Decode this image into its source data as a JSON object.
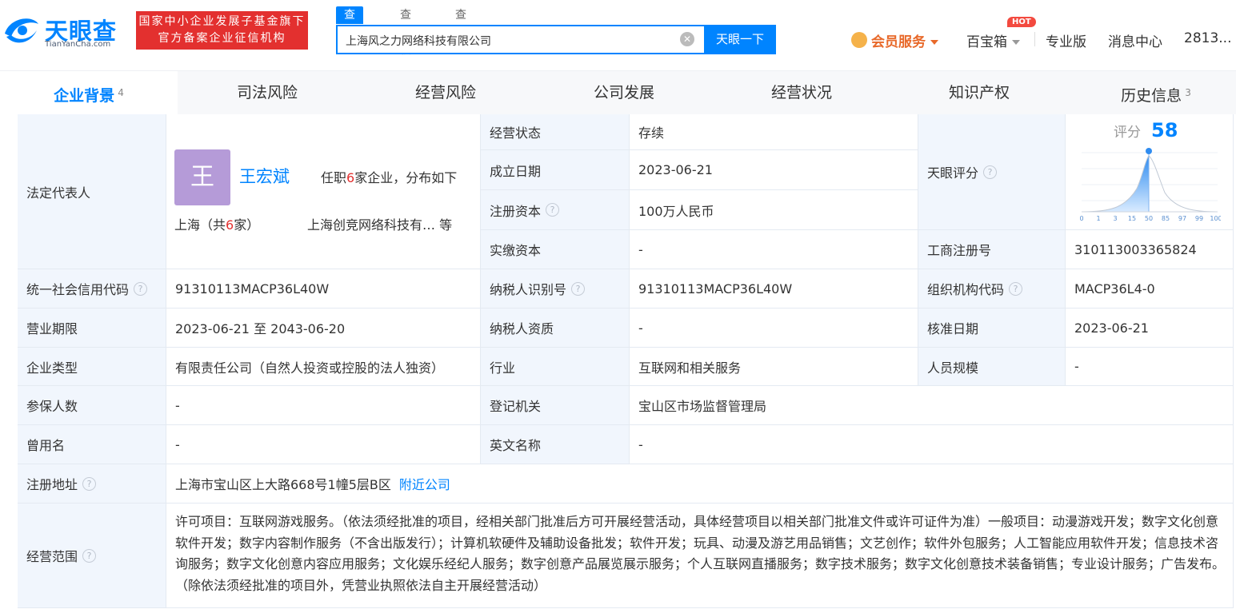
{
  "header": {
    "logo_text": "天眼查",
    "logo_sub": "TianYanCha.com",
    "gov_badge_line1": "国家中小企业发展子基金旗下",
    "gov_badge_line2": "官方备案企业征信机构",
    "search_tabs": [
      "查公司",
      "查老板",
      "查关系"
    ],
    "search_value": "上海风之力网络科技有限公司",
    "search_button": "天眼一下",
    "vip_label": "会员服务",
    "treasure_label": "百宝箱",
    "hot_badge": "HOT",
    "pro_label": "专业版",
    "message_label": "消息中心",
    "user_label": "2813..."
  },
  "tabs": [
    {
      "label": "企业背景",
      "count": "4"
    },
    {
      "label": "司法风险",
      "count": ""
    },
    {
      "label": "经营风险",
      "count": ""
    },
    {
      "label": "公司发展",
      "count": ""
    },
    {
      "label": "经营状况",
      "count": ""
    },
    {
      "label": "知识产权",
      "count": ""
    },
    {
      "label": "历史信息",
      "count": "3"
    }
  ],
  "info": {
    "legal_rep_label": "法定代表人",
    "avatar_char": "王",
    "legal_rep_name": "王宏斌",
    "rep_count_prefix": "任职",
    "rep_count_num": "6",
    "rep_count_suffix": "家企业，分布如下",
    "rep_loc_prefix": "上海（共",
    "rep_loc_num": "6",
    "rep_loc_suffix": "家）",
    "rep_company": "上海创竞网络科技有…  等",
    "status_label": "经营状态",
    "status_value": "存续",
    "found_label": "成立日期",
    "found_value": "2023-06-21",
    "capital_label": "注册资本",
    "capital_value": "100万人民币",
    "paid_label": "实缴资本",
    "paid_value": "-",
    "score_cell_label": "天眼评分",
    "score_label": "评分",
    "score_value": "58",
    "score_axis": [
      "0",
      "1",
      "3",
      "15",
      "50",
      "85",
      "97",
      "99",
      "100"
    ],
    "reg_no_label": "工商注册号",
    "reg_no_value": "310113003365824",
    "credit_label": "统一社会信用代码",
    "credit_value": "91310113MACP36L40W",
    "taxid_label": "纳税人识别号",
    "taxid_value": "91310113MACP36L40W",
    "org_label": "组织机构代码",
    "org_value": "MACP36L4-0",
    "term_label": "营业期限",
    "term_value": "2023-06-21 至 2043-06-20",
    "tax_qual_label": "纳税人资质",
    "tax_qual_value": "-",
    "approve_label": "核准日期",
    "approve_value": "2023-06-21",
    "type_label": "企业类型",
    "type_value": "有限责任公司（自然人投资或控股的法人独资）",
    "industry_label": "行业",
    "industry_value": "互联网和相关服务",
    "staff_label": "人员规模",
    "staff_value": "-",
    "insured_label": "参保人数",
    "insured_value": "-",
    "authority_label": "登记机关",
    "authority_value": "宝山区市场监督管理局",
    "former_label": "曾用名",
    "former_value": "-",
    "english_label": "英文名称",
    "english_value": "-",
    "address_label": "注册地址",
    "address_value": "上海市宝山区上大路668号1幢5层B区",
    "nearby_link": "附近公司",
    "scope_label": "经营范围",
    "scope_value": "许可项目：互联网游戏服务。（依法须经批准的项目，经相关部门批准后方可开展经营活动，具体经营项目以相关部门批准文件或许可证件为准）一般项目：动漫游戏开发；数字文化创意软件开发；数字内容制作服务（不含出版发行）；计算机软硬件及辅助设备批发；软件开发；玩具、动漫及游艺用品销售；文艺创作；软件外包服务；人工智能应用软件开发；信息技术咨询服务；数字文化创意内容应用服务；文化娱乐经纪人服务；数字创意产品展览展示服务；个人互联网直播服务；数字技术服务；数字文化创意技术装备销售；专业设计服务；广告发布。（除依法须经批准的项目外，凭营业执照依法自主开展经营活动）"
  }
}
